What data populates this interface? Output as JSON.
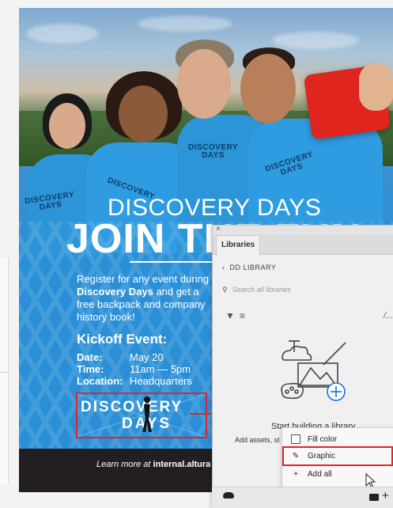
{
  "poster": {
    "shirt_logo_line1": "DISCOVERY",
    "shirt_logo_line2": "DAYS",
    "heading_small": "DISCOVERY DAYS",
    "heading_big": "JOIN THE FUN",
    "register_line1": "Register for any event during",
    "register_bold": "Discovery Days",
    "register_after_bold": " and get a",
    "register_line3": "free backpack and company",
    "register_line4": "history book!",
    "kickoff_title": "Kickoff Event:",
    "details": [
      {
        "key": "Date:",
        "value": "May 20"
      },
      {
        "key": "Time:",
        "value": "11am — 5pm"
      },
      {
        "key": "Location:",
        "value": "Headquarters"
      }
    ],
    "logo_line1": "DISCOVERY",
    "logo_line2": "DAYS",
    "footer_prefix": "Learn more at ",
    "footer_url": "internal.altura"
  },
  "panel": {
    "close_glyph": "×",
    "tab_label": "Libraries",
    "back_label": "DD LIBRARY",
    "search_placeholder": "Search all libraries",
    "menu_glyph": "/...",
    "start_text": "Start building a library",
    "add_assets_text": "Add assets, st"
  },
  "context_menu": {
    "items": [
      {
        "label": "Fill color",
        "icon": "checkbox-icon"
      },
      {
        "label": "Graphic",
        "icon": "brush-icon"
      },
      {
        "label": "Add all",
        "icon": "plus-icon"
      }
    ]
  },
  "colors": {
    "highlight_red": "#e0242a",
    "poster_blue": "#2a8fd6",
    "footer_dark": "#231f20"
  }
}
